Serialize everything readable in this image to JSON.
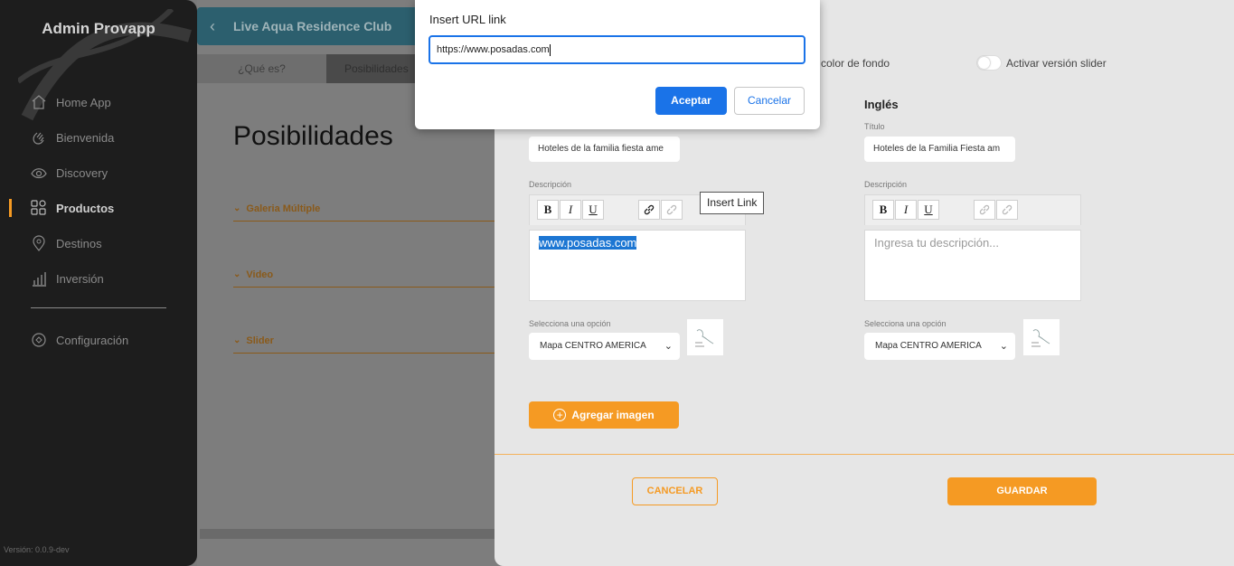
{
  "sidebar": {
    "brand": "Admin Provapp",
    "items": [
      {
        "label": "Home App",
        "icon": "home-icon"
      },
      {
        "label": "Bienvenida",
        "icon": "wave-hand-icon"
      },
      {
        "label": "Discovery",
        "icon": "eye-icon"
      },
      {
        "label": "Productos",
        "icon": "grid-icon",
        "active": true
      },
      {
        "label": "Destinos",
        "icon": "map-pin-icon"
      },
      {
        "label": "Inversión",
        "icon": "bar-chart-icon"
      }
    ],
    "settings": {
      "label": "Configuración",
      "icon": "settings-icon"
    },
    "version": "Versión: 0.0.9-dev"
  },
  "header": {
    "title": "Live Aqua Residence Club",
    "back_icon": "chevron-left-icon"
  },
  "tabs": [
    "¿Qué es?",
    "Posibilidades"
  ],
  "page_title": "Posibilidades",
  "accordion": [
    "Galeria Múltiple",
    "Video",
    "Slider"
  ],
  "panel": {
    "option_bg_label": "color de fondo",
    "slider_toggle_label": "Activar versión slider",
    "english_heading": "Inglés",
    "spanish": {
      "title_value": "Hoteles de la familia fiesta ame",
      "description_label": "Descripción",
      "description_text": "www.posadas.com",
      "select_label": "Selecciona una opción",
      "select_value": "Mapa CENTRO AMERICA"
    },
    "english": {
      "title_label": "Título",
      "title_value": "Hoteles de la Familia Fiesta am",
      "description_label": "Descripción",
      "description_placeholder": "Ingresa tu descripción...",
      "select_label": "Selecciona una opción",
      "select_value": "Mapa CENTRO AMERICA"
    },
    "tooltip": "Insert Link",
    "add_image_label": "Agregar imagen",
    "cancel_label": "CANCELAR",
    "save_label": "GUARDAR"
  },
  "dialog": {
    "label": "Insert URL link",
    "input_value": "https://www.posadas.com",
    "ok_label": "Aceptar",
    "cancel_label": "Cancelar"
  },
  "colors": {
    "accent": "#f59a23",
    "dialog_primary": "#1a73e8",
    "selection": "#1c76d3"
  }
}
